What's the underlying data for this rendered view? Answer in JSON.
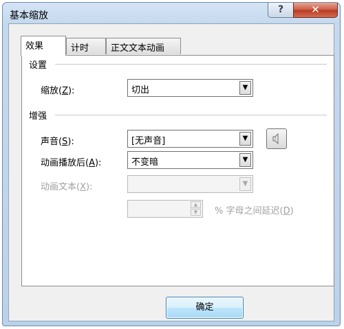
{
  "window": {
    "title": "基本缩放",
    "help_label": "?",
    "close_label": "✕"
  },
  "tabs": [
    {
      "label": "效果",
      "active": true
    },
    {
      "label": "计时",
      "active": false
    },
    {
      "label": "正文文本动画",
      "active": false
    }
  ],
  "settings": {
    "group_title": "设置",
    "zoom_label": "缩放(",
    "zoom_key": "Z",
    "zoom_label_end": "):",
    "zoom_value": "切出"
  },
  "enhance": {
    "group_title": "增强",
    "sound_label": "声音(",
    "sound_key": "S",
    "sound_label_end": "):",
    "sound_value": "[无声音]",
    "sound_icon": "speaker-icon",
    "after_label": "动画播放后(",
    "after_key": "A",
    "after_label_end": "):",
    "after_value": "不变暗",
    "text_label": "动画文本(",
    "text_key": "X",
    "text_label_end": "):",
    "text_value": "",
    "delay_value": "",
    "delay_label": "% 字母之间延迟(",
    "delay_key": "D",
    "delay_label_end": ")"
  },
  "buttons": {
    "ok_label": "确定"
  },
  "colors": {
    "title_bar": "#c5d9ee",
    "close_button": "#c95a44",
    "ok_button": "#bee6fd"
  }
}
